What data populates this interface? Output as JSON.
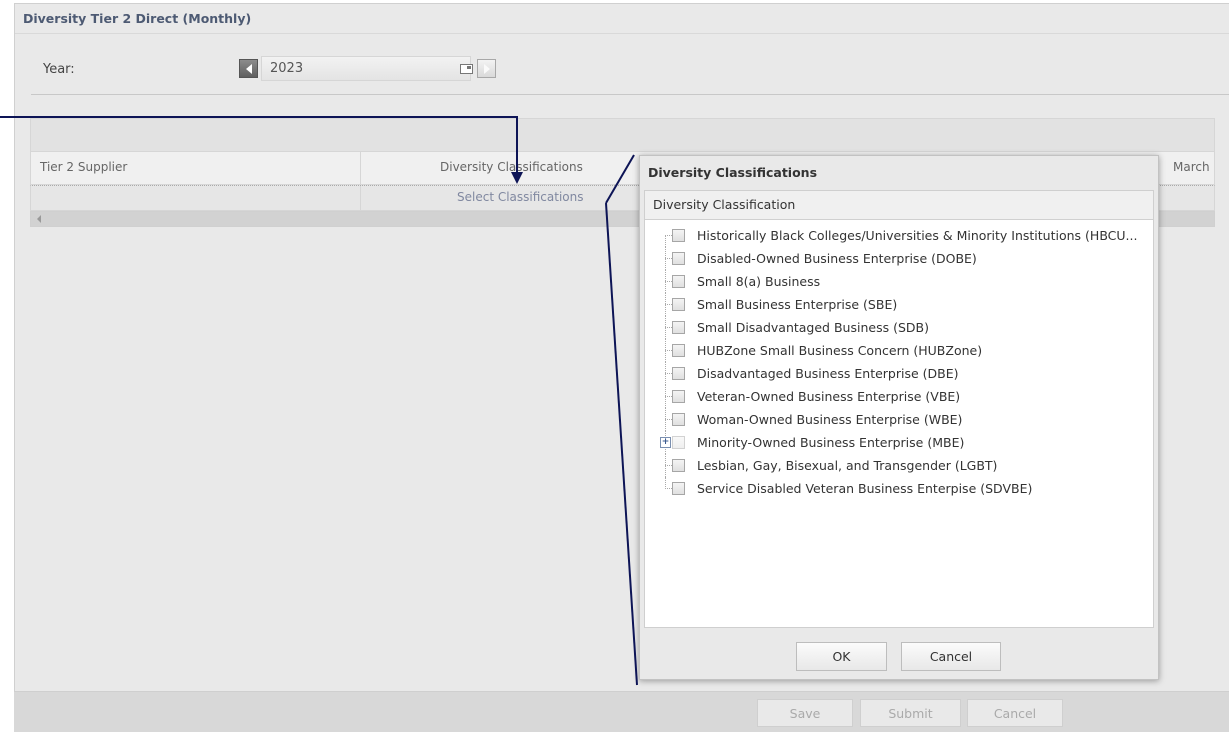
{
  "panel": {
    "title": "Diversity Tier 2 Direct (Monthly)"
  },
  "year": {
    "label": "Year:",
    "value": "2023"
  },
  "grid": {
    "headers": {
      "supplier": "Tier 2 Supplier",
      "classifications": "Diversity Classifications",
      "month": "March"
    },
    "row": {
      "select_link": "Select Classifications"
    }
  },
  "footer": {
    "save": "Save",
    "submit": "Submit",
    "cancel": "Cancel"
  },
  "dialog": {
    "title": "Diversity Classifications",
    "column_header": "Diversity Classification",
    "items": [
      {
        "label": "Historically Black Colleges/Universities & Minority Institutions (HBCU...",
        "expandable": false,
        "checked": false
      },
      {
        "label": "Disabled-Owned Business Enterprise (DOBE)",
        "expandable": false,
        "checked": false
      },
      {
        "label": "Small 8(a) Business",
        "expandable": false,
        "checked": false
      },
      {
        "label": "Small Business Enterprise (SBE)",
        "expandable": false,
        "checked": false
      },
      {
        "label": "Small Disadvantaged Business (SDB)",
        "expandable": false,
        "checked": false
      },
      {
        "label": "HUBZone Small Business Concern (HUBZone)",
        "expandable": false,
        "checked": false
      },
      {
        "label": "Disadvantaged Business Enterprise (DBE)",
        "expandable": false,
        "checked": false
      },
      {
        "label": "Veteran-Owned Business Enterprise (VBE)",
        "expandable": false,
        "checked": false
      },
      {
        "label": "Woman-Owned Business Enterprise (WBE)",
        "expandable": false,
        "checked": false
      },
      {
        "label": "Minority-Owned Business Enterprise (MBE)",
        "expandable": true,
        "checked": false
      },
      {
        "label": "Lesbian, Gay, Bisexual, and Transgender (LGBT)",
        "expandable": false,
        "checked": false
      },
      {
        "label": "Service Disabled Veteran Business Enterpise (SDVBE)",
        "expandable": false,
        "checked": false
      }
    ],
    "ok": "OK",
    "cancel": "Cancel"
  },
  "colors": {
    "annotation_line": "#0d1456",
    "title_text": "#4d5a73",
    "link_text": "#8088a0"
  }
}
